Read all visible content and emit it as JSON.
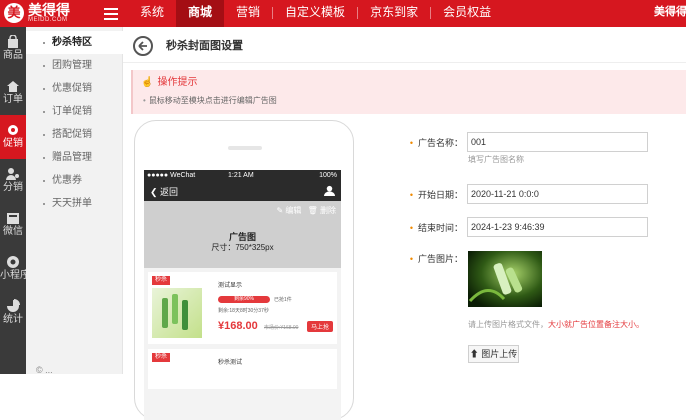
{
  "header": {
    "logo_text": "美得得",
    "logo_mark": "美",
    "logo_sub": "MEIDD.COM",
    "nav": [
      "系统",
      "商城",
      "营销",
      "自定义模板",
      "京东到家",
      "会员权益"
    ],
    "active_nav": 1,
    "brand_right": "美得得"
  },
  "iconbar": [
    {
      "label": "商品",
      "icon": "shopping-bag-icon"
    },
    {
      "label": "订单",
      "icon": "order-icon"
    },
    {
      "label": "促销",
      "icon": "promotion-icon",
      "active": true
    },
    {
      "label": "分销",
      "icon": "distribution-icon"
    },
    {
      "label": "微信",
      "icon": "wechat-icon"
    },
    {
      "label": "小程序",
      "icon": "mini-program-icon"
    },
    {
      "label": "统计",
      "icon": "statistics-icon"
    }
  ],
  "submenu": [
    "秒杀特区",
    "团购管理",
    "优惠促销",
    "订单促销",
    "搭配促销",
    "赠品管理",
    "优惠券",
    "天天拼单"
  ],
  "footer_copy": "© ...",
  "page": {
    "title": "秒杀封面图设置",
    "tips_title": "操作提示",
    "tips_body": "鼠标移动至模块点击进行编辑广告图"
  },
  "phone": {
    "status_left": "●●●●● WeChat",
    "status_time": "1:21 AM",
    "status_right": "100%",
    "back_label": "返回",
    "edit_label": "编辑",
    "delete_label": "删除",
    "banner_title": "广告图",
    "banner_size": "尺寸：750*325px",
    "goods": [
      {
        "tag": "秒杀",
        "name": "测试显示",
        "progress_label": "剩余90%",
        "progress": 0.9,
        "sold": "已抢1件",
        "countdown": "剩余:18天8时30分37秒",
        "price": "¥168.00",
        "old_price": "市场价:¥168.00",
        "buy": "马上抢"
      },
      {
        "tag": "秒杀",
        "name": "秒杀测试"
      }
    ]
  },
  "form": {
    "name_label": "广告名称：",
    "name_value": "001",
    "name_help": "填写广告图名称",
    "start_label": "开始日期：",
    "start_value": "2020-11-21 0:0:0",
    "end_label": "结束时间：",
    "end_value": "2024-1-23 9:46:39",
    "image_label": "广告图片：",
    "image_hint": "请上传图片格式文件，",
    "image_hint_red": "大小就广告位置备注大小。",
    "upload_label": "图片上传"
  },
  "colors": {
    "brand": "#d6171f",
    "nav_active": "#a40e14",
    "sidebar": "#3a3a3a",
    "tips_bg": "#fde9ea",
    "price": "#e4393c"
  }
}
